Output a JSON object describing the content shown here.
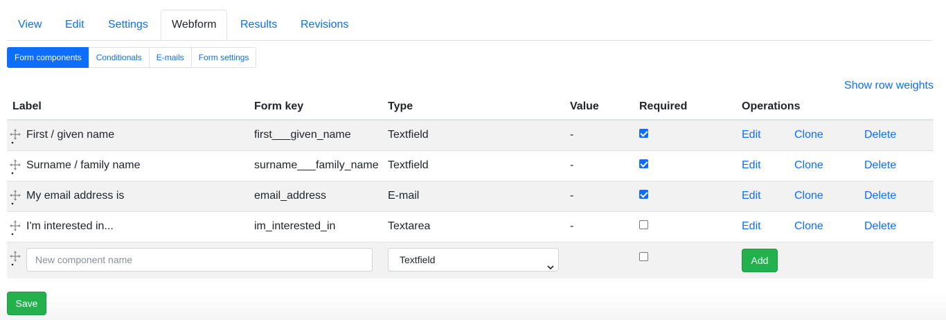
{
  "tabs": [
    {
      "label": "View"
    },
    {
      "label": "Edit"
    },
    {
      "label": "Settings"
    },
    {
      "label": "Webform"
    },
    {
      "label": "Results"
    },
    {
      "label": "Revisions"
    }
  ],
  "subtabs": [
    {
      "label": "Form components"
    },
    {
      "label": "Conditionals"
    },
    {
      "label": "E-mails"
    },
    {
      "label": "Form settings"
    }
  ],
  "show_row_weights": "Show row weights",
  "table": {
    "headers": {
      "label": "Label",
      "form_key": "Form key",
      "type": "Type",
      "value": "Value",
      "required": "Required",
      "operations": "Operations"
    },
    "rows": [
      {
        "label": "First / given name",
        "form_key": "first___given_name",
        "type": "Textfield",
        "value": "-",
        "required": true
      },
      {
        "label": "Surname / family name",
        "form_key": "surname___family_name",
        "type": "Textfield",
        "value": "-",
        "required": true
      },
      {
        "label": "My email address is",
        "form_key": "email_address",
        "type": "E-mail",
        "value": "-",
        "required": true
      },
      {
        "label": "I'm interested in...",
        "form_key": "im_interested_in",
        "type": "Textarea",
        "value": "-",
        "required": false
      }
    ],
    "ops": {
      "edit": "Edit",
      "clone": "Clone",
      "delete": "Delete"
    },
    "new_row": {
      "placeholder": "New component name",
      "type_selected": "Textfield",
      "required": false,
      "add_label": "Add"
    }
  },
  "save_label": "Save",
  "colors": {
    "link": "#0d6efd",
    "green": "#22b14c",
    "stripe": "#f2f2f2"
  }
}
